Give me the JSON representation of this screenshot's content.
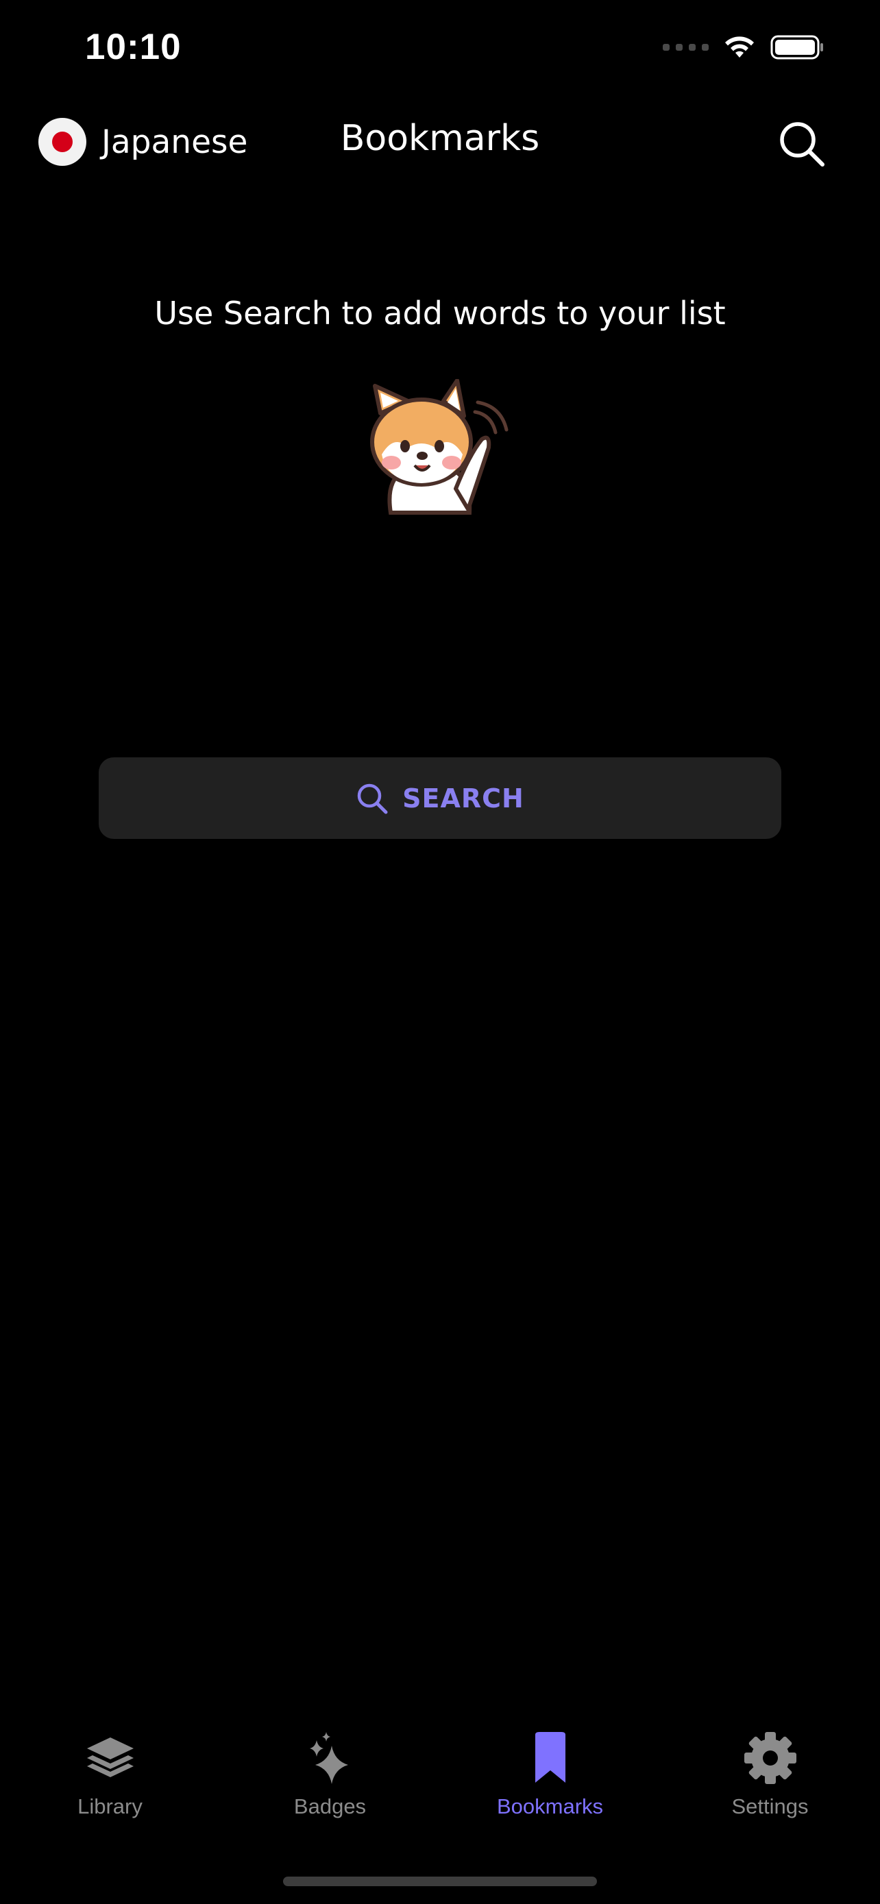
{
  "status_bar": {
    "time": "10:10"
  },
  "header": {
    "language": "Japanese",
    "title": "Bookmarks",
    "search_icon": "search-icon"
  },
  "empty_state": {
    "message": "Use Search to add words to your list",
    "mascot": "shiba-dog-waving"
  },
  "search_button": {
    "label": "SEARCH",
    "icon": "search-icon"
  },
  "tabs": [
    {
      "label": "Library",
      "icon": "stack-layers-icon",
      "active": false
    },
    {
      "label": "Badges",
      "icon": "sparkle-icon",
      "active": false
    },
    {
      "label": "Bookmarks",
      "icon": "bookmark-icon",
      "active": true
    },
    {
      "label": "Settings",
      "icon": "gear-icon",
      "active": false
    }
  ],
  "colors": {
    "background": "#000000",
    "accent": "#7f72ff",
    "button_bg": "#212121",
    "tab_inactive": "#8c8c8c",
    "flag_red": "#d40018"
  }
}
